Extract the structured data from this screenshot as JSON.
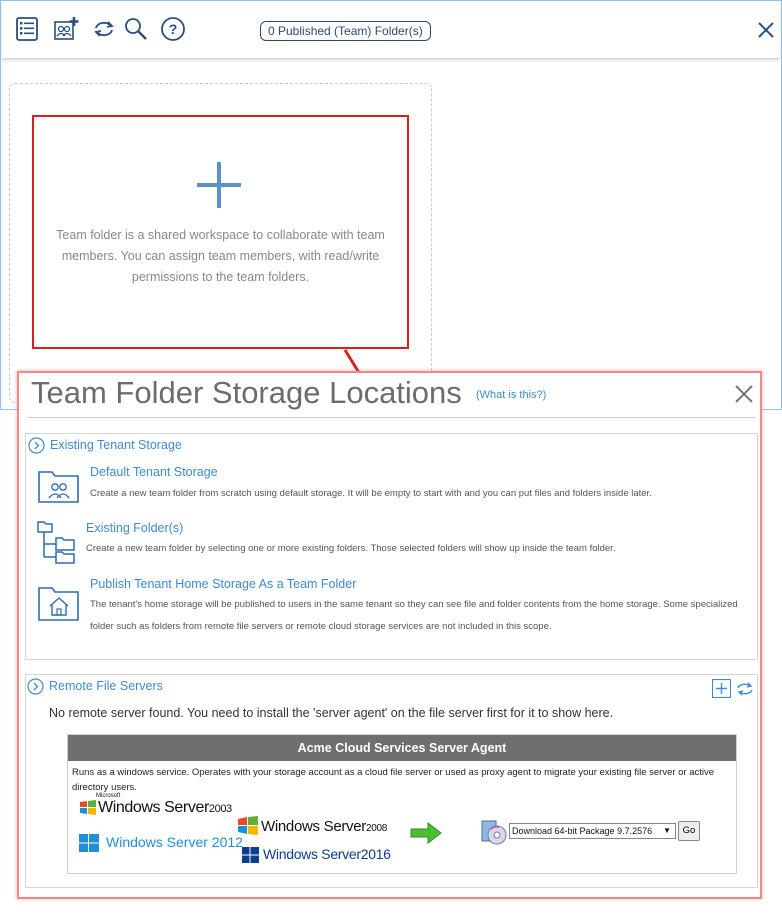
{
  "toolbar": {
    "published_badge": "0 Published (Team) Folder(s)"
  },
  "add_card": {
    "description": "Team folder is a shared workspace to collaborate with team members. You can assign team members, with read/write permissions to the team folders."
  },
  "dialog": {
    "title": "Team Folder Storage Locations",
    "whats_this": "(What is this?)",
    "existing_section": {
      "title": "Existing Tenant Storage",
      "options": [
        {
          "title": "Default Tenant Storage",
          "description": "Create a new team folder from scratch using default storage. It will be empty to start with and you can put files and folders inside later.",
          "icon": "team-folder-icon"
        },
        {
          "title": "Existing Folder(s)",
          "description": "Create a new team folder by selecting one or more existing folders. Those selected folders will show up inside the team folder.",
          "icon": "folder-tree-icon"
        },
        {
          "title": "Publish Tenant Home Storage As a Team Folder",
          "description": "The tenant's home storage will be published to users in the same tenant so they can see file and folder contents from the home storage. Some specialized folder such as folders from remote file servers or remote cloud storage services are not included in this scope.",
          "icon": "home-folder-icon"
        }
      ]
    },
    "remote_section": {
      "title": "Remote File Servers",
      "empty_message": "No remote server found. You need to install the 'server agent' on the file server first for it to show here."
    },
    "agent": {
      "heading": "Acme Cloud Services Server Agent",
      "description": "Runs as a windows service. Operates with your storage account as a cloud file server or used as proxy agent to migrate your existing file server or active directory users.",
      "logos": {
        "ws2003_ms": "Microsoft",
        "ws2003_name": "Windows Server",
        "ws2003_ver": "2003",
        "ws2008_name": "Windows Server",
        "ws2008_ver": "2008",
        "ws2012": "Windows Server 2012",
        "ws2016_name": "Windows Server",
        "ws2016_ver": "2016"
      },
      "package_select": "Download 64-bit Package 9.7.2576",
      "go_label": "Go"
    }
  },
  "colors": {
    "accent": "#3d8ccc",
    "highlight": "#dd1f1f",
    "dialog_border": "#f08a8a"
  }
}
